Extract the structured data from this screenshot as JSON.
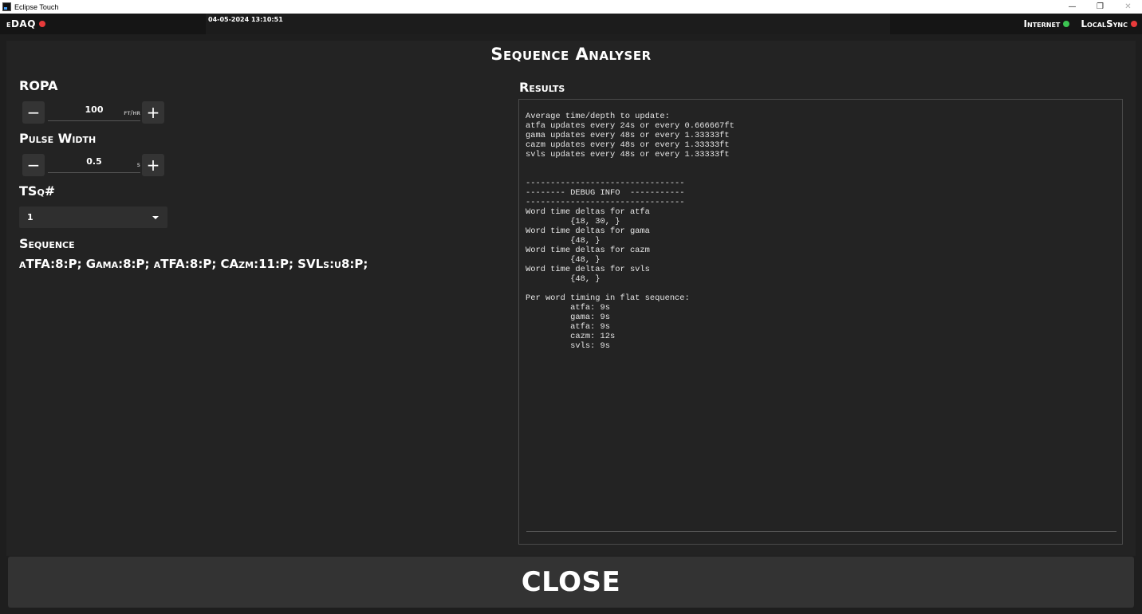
{
  "window": {
    "title": "Eclipse Touch",
    "minimize_glyph": "—",
    "restore_glyph": "❐",
    "close_glyph": "✕"
  },
  "header": {
    "brand": "eDAQ",
    "datetime": "04-05-2024 13:10:51",
    "internet_label": "Internet",
    "localsync_label": "LocalSync",
    "status_colors": {
      "brand": "#e83b3b",
      "internet": "#3cc452",
      "localsync": "#e83b3b"
    }
  },
  "panel": {
    "title": "Sequence Analyser",
    "ropa": {
      "label": "ROPA",
      "value": "100",
      "unit": "ft/hr",
      "decrement": "−",
      "increment": "+"
    },
    "pulse_width": {
      "label": "Pulse Width",
      "value": "0.5",
      "unit": "s",
      "decrement": "−",
      "increment": "+"
    },
    "tsq": {
      "label": "TSq#",
      "selected": "1"
    },
    "sequence": {
      "label": "Sequence",
      "text": "aTFA:8:P; Gama:8:P; aTFA:8:P; CAzm:11:P; SVLs:u8:P;"
    },
    "results": {
      "label": "Results",
      "text": "Average time/depth to update:\natfa updates every 24s or every 0.666667ft\ngama updates every 48s or every 1.33333ft\ncazm updates every 48s or every 1.33333ft\nsvls updates every 48s or every 1.33333ft\n\n\n--------------------------------\n-------- DEBUG INFO  -----------\n--------------------------------\nWord time deltas for atfa\n         {18, 30, }\nWord time deltas for gama\n         {48, }\nWord time deltas for cazm\n         {48, }\nWord time deltas for svls\n         {48, }\n\nPer word timing in flat sequence:\n         atfa: 9s\n         gama: 9s\n         atfa: 9s\n         cazm: 12s\n         svls: 9s"
    }
  },
  "close_button": {
    "label": "CLOSE"
  }
}
